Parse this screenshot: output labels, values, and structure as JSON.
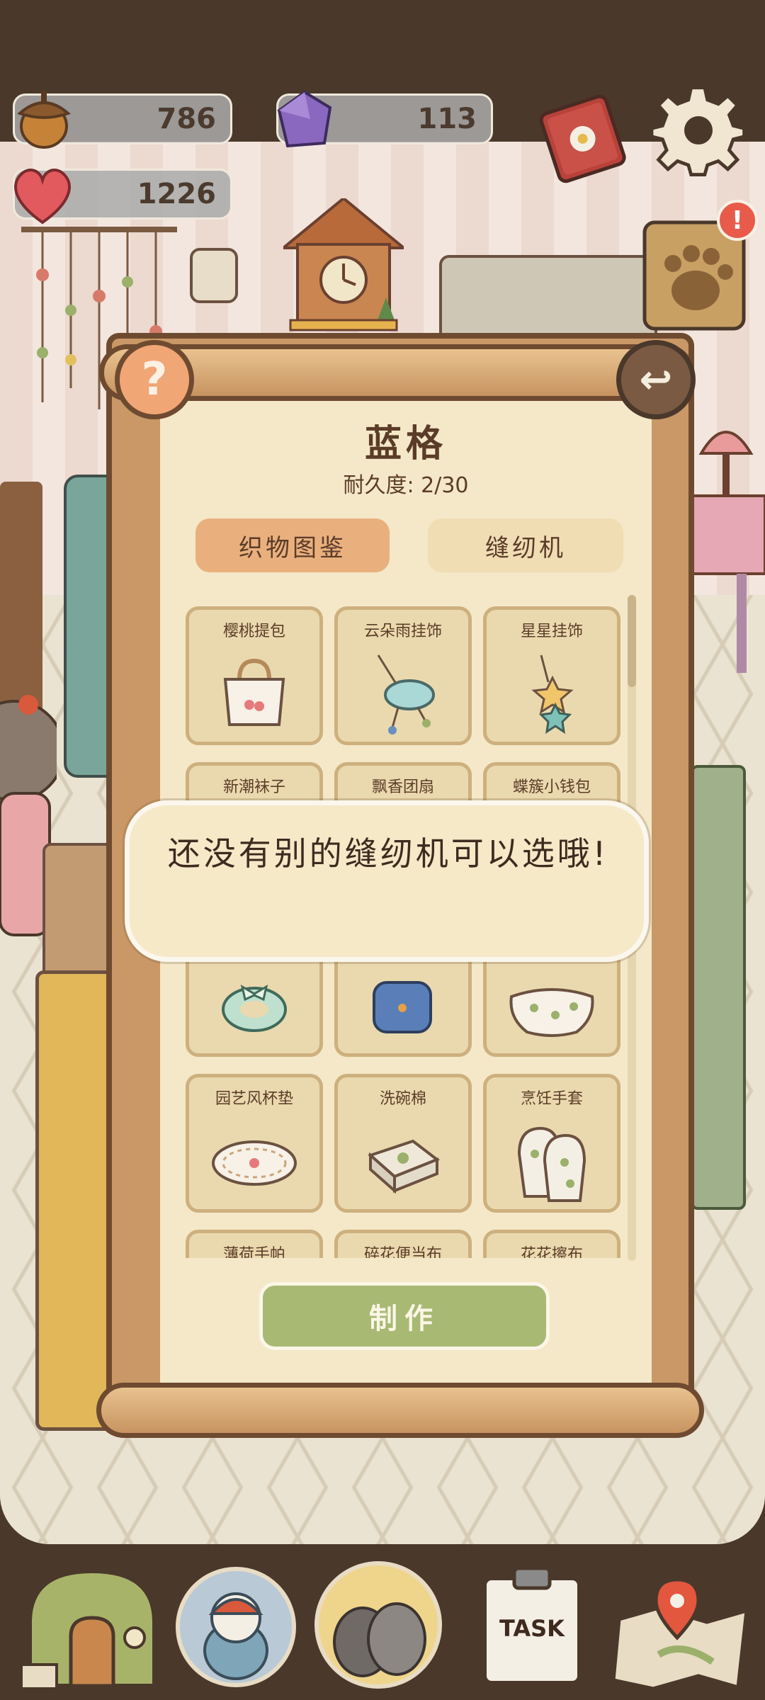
{
  "resources": {
    "acorns": "786",
    "gems": "113",
    "hearts": "1226"
  },
  "notification_badge": "!",
  "help_glyph": "?",
  "back_glyph": "↩",
  "panel": {
    "title": "蓝格",
    "durability": "耐久度: 2/30",
    "tabs": [
      "织物图鉴",
      "缝纫机"
    ],
    "active_tab": "织物图鉴",
    "items": [
      {
        "label": "樱桃提包",
        "icon": "tote-bag-icon"
      },
      {
        "label": "云朵雨挂饰",
        "icon": "cloud-charm-icon"
      },
      {
        "label": "星星挂饰",
        "icon": "star-charm-icon"
      },
      {
        "label": "新潮袜子",
        "icon": "scrunchie-icon"
      },
      {
        "label": "飘香团扇",
        "icon": "pillow-icon"
      },
      {
        "label": "蝶簇小钱包",
        "icon": "pouch-icon"
      },
      {
        "label": "园艺风杯垫",
        "icon": "coaster-icon"
      },
      {
        "label": "洗碗棉",
        "icon": "sponge-icon"
      },
      {
        "label": "烹饪手套",
        "icon": "oven-mitt-icon"
      },
      {
        "label": "薄荷手帕",
        "icon": "handkerchief-icon"
      },
      {
        "label": "碎花便当布",
        "icon": "bento-cloth-icon"
      },
      {
        "label": "花花擦布",
        "icon": "cloth-icon"
      }
    ],
    "make_button": "制作"
  },
  "toast": {
    "message": "还没有别的缝纫机可以选哦!"
  },
  "bottom_nav": {
    "task_label": "TASK",
    "items": [
      "house-icon",
      "character-icon",
      "pigeons-icon",
      "task-clipboard-icon",
      "map-icon"
    ]
  },
  "colors": {
    "paper": "#f4e8c8",
    "frame": "#c99866",
    "make_button": "#a8b974",
    "tab_active": "#e9b07e",
    "tab_inactive": "#f0ddb4",
    "help_button": "#f1a676"
  }
}
